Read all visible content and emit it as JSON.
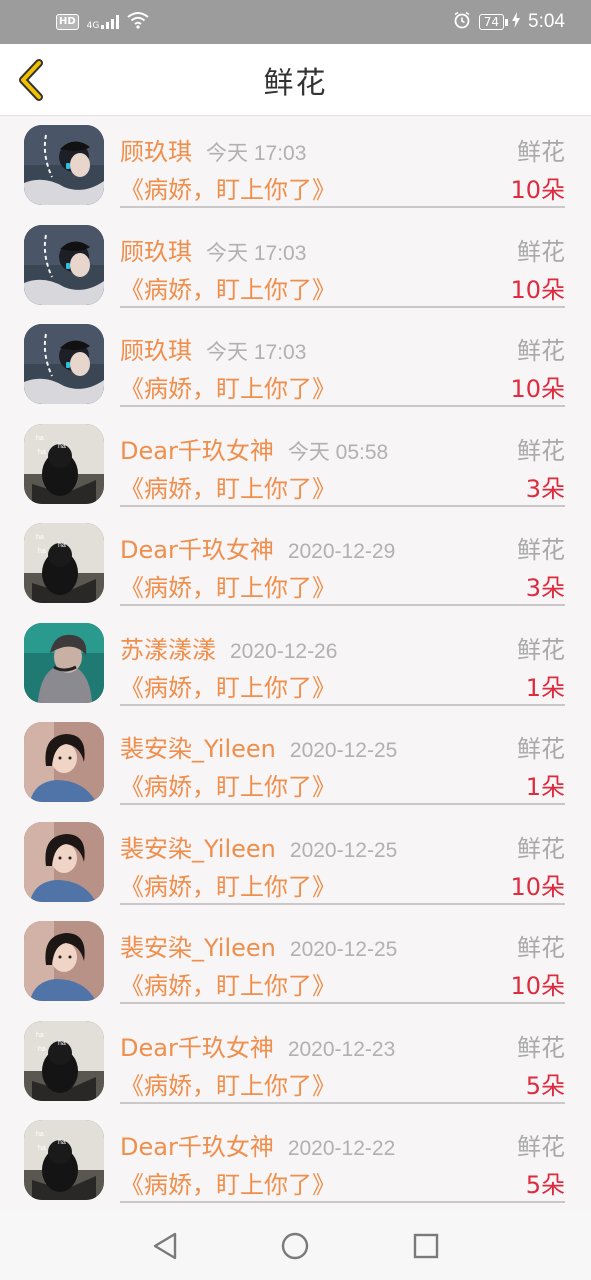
{
  "status_bar": {
    "network_badge": "HD",
    "signal_label": "4G",
    "battery_level": "74",
    "time": "5:04",
    "icons": [
      "hd-icon",
      "signal-icon",
      "wifi-icon",
      "alarm-icon",
      "battery-icon",
      "charging-icon"
    ]
  },
  "header": {
    "title": "鲜花",
    "back_icon": "chevron-left-icon",
    "accent_color": "#f2c200"
  },
  "colors": {
    "name": "#f08e4b",
    "time": "#b1b1b1",
    "count": "#dd2c3f",
    "type": "#a9a9a9"
  },
  "records": [
    {
      "user": "顾玖琪",
      "time": "今天 17:03",
      "book": "《病娇，盯上你了》",
      "type": "鲜花",
      "count": "10朵",
      "avatar": "boy-profile"
    },
    {
      "user": "顾玖琪",
      "time": "今天 17:03",
      "book": "《病娇，盯上你了》",
      "type": "鲜花",
      "count": "10朵",
      "avatar": "boy-profile"
    },
    {
      "user": "顾玖琪",
      "time": "今天 17:03",
      "book": "《病娇，盯上你了》",
      "type": "鲜花",
      "count": "10朵",
      "avatar": "boy-profile"
    },
    {
      "user": "Dear千玖女神",
      "time": "今天 05:58",
      "book": "《病娇，盯上你了》",
      "type": "鲜花",
      "count": "3朵",
      "avatar": "dark-figure"
    },
    {
      "user": "Dear千玖女神",
      "time": "2020-12-29",
      "book": "《病娇，盯上你了》",
      "type": "鲜花",
      "count": "3朵",
      "avatar": "dark-figure"
    },
    {
      "user": "苏漾漾漾",
      "time": "2020-12-26",
      "book": "《病娇，盯上你了》",
      "type": "鲜花",
      "count": "1朵",
      "avatar": "teal-portrait"
    },
    {
      "user": "裴安染_Yileen",
      "time": "2020-12-25",
      "book": "《病娇，盯上你了》",
      "type": "鲜花",
      "count": "1朵",
      "avatar": "girl-portrait"
    },
    {
      "user": "裴安染_Yileen",
      "time": "2020-12-25",
      "book": "《病娇，盯上你了》",
      "type": "鲜花",
      "count": "10朵",
      "avatar": "girl-portrait"
    },
    {
      "user": "裴安染_Yileen",
      "time": "2020-12-25",
      "book": "《病娇，盯上你了》",
      "type": "鲜花",
      "count": "10朵",
      "avatar": "girl-portrait"
    },
    {
      "user": "Dear千玖女神",
      "time": "2020-12-23",
      "book": "《病娇，盯上你了》",
      "type": "鲜花",
      "count": "5朵",
      "avatar": "dark-figure"
    },
    {
      "user": "Dear千玖女神",
      "time": "2020-12-22",
      "book": "《病娇，盯上你了》",
      "type": "鲜花",
      "count": "5朵",
      "avatar": "dark-figure"
    }
  ],
  "nav_bar": {
    "icons": [
      "back-triangle-icon",
      "home-circle-icon",
      "recents-square-icon"
    ]
  }
}
